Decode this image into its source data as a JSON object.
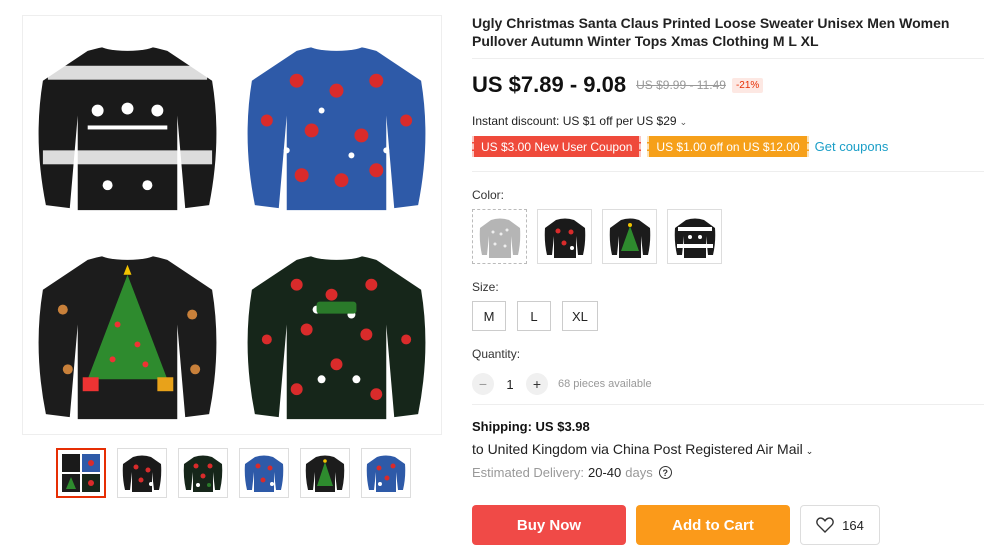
{
  "product": {
    "title": "Ugly Christmas Santa Claus Printed Loose Sweater Unisex Men Women Pullover Autumn Winter Tops Xmas Clothing M L XL"
  },
  "pricing": {
    "price": "US $7.89 - 9.08",
    "original_price": "US $9.99 - 11.49",
    "discount": "-21%"
  },
  "discounts": {
    "instant": "Instant discount: US $1 off per US $29",
    "coupon_1": "US $3.00 New User Coupon",
    "coupon_2": "US $1.00 off on US $12.00",
    "get_coupons": "Get coupons"
  },
  "colors": {
    "label": "Color:",
    "options": [
      "gray-sweater",
      "black-santa-sweater",
      "black-tree-sweater",
      "black-reindeer-sweater"
    ]
  },
  "sizes": {
    "label": "Size:",
    "options": [
      "M",
      "L",
      "XL"
    ]
  },
  "quantity": {
    "label": "Quantity:",
    "minus": "−",
    "value": "1",
    "plus": "+",
    "available": "68 pieces available"
  },
  "shipping": {
    "title": "Shipping: US $3.98",
    "destination": "to United Kingdom via China Post Registered Air Mail",
    "eta_label": "Estimated Delivery:",
    "eta_value": "20-40",
    "eta_unit": "days",
    "help": "?"
  },
  "actions": {
    "buy_now": "Buy Now",
    "add_to_cart": "Add to Cart",
    "wishlist_count": "164"
  },
  "gallery": {
    "thumbnails": [
      "all-four-sweaters",
      "black-santa-sweater",
      "black-santa-sweater-2",
      "blue-santa-sweater",
      "black-tree-sweater",
      "blue-santa-sweater-2"
    ],
    "active_index": 0
  },
  "theme": {
    "price_red": "#e62e04",
    "buy_red": "#f04a47",
    "cart_orange": "#fb9a1a",
    "link_blue": "#1a9ec7"
  }
}
